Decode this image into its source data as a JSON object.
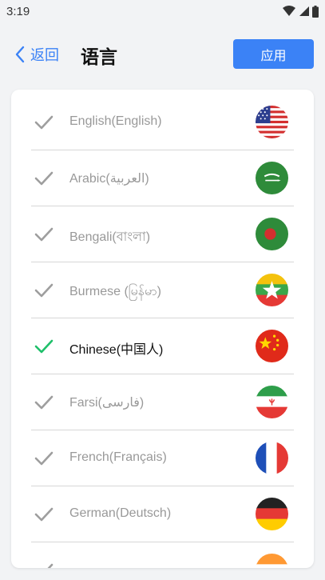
{
  "status_bar": {
    "time": "3:19"
  },
  "header": {
    "back_label": "返回",
    "title": "语言",
    "apply_label": "应用"
  },
  "colors": {
    "accent": "#3b82f6",
    "check_selected": "#1fbf6a",
    "check_default": "#9e9e9e"
  },
  "languages": [
    {
      "label": "English(English)",
      "selected": false,
      "flag": "us-flag-icon"
    },
    {
      "label": "Arabic(العربية)",
      "selected": false,
      "flag": "saudi-flag-icon"
    },
    {
      "label": "Bengali(বাংলা)",
      "selected": false,
      "flag": "bangladesh-flag-icon"
    },
    {
      "label": "Burmese (မြန်မာ)",
      "selected": false,
      "flag": "myanmar-flag-icon"
    },
    {
      "label": "Chinese(中国人)",
      "selected": true,
      "flag": "china-flag-icon"
    },
    {
      "label": "Farsi(فارسی)",
      "selected": false,
      "flag": "iran-flag-icon"
    },
    {
      "label": "French(Français)",
      "selected": false,
      "flag": "france-flag-icon"
    },
    {
      "label": "German(Deutsch)",
      "selected": false,
      "flag": "germany-flag-icon"
    },
    {
      "label": "",
      "selected": false,
      "flag": "india-flag-icon"
    }
  ]
}
